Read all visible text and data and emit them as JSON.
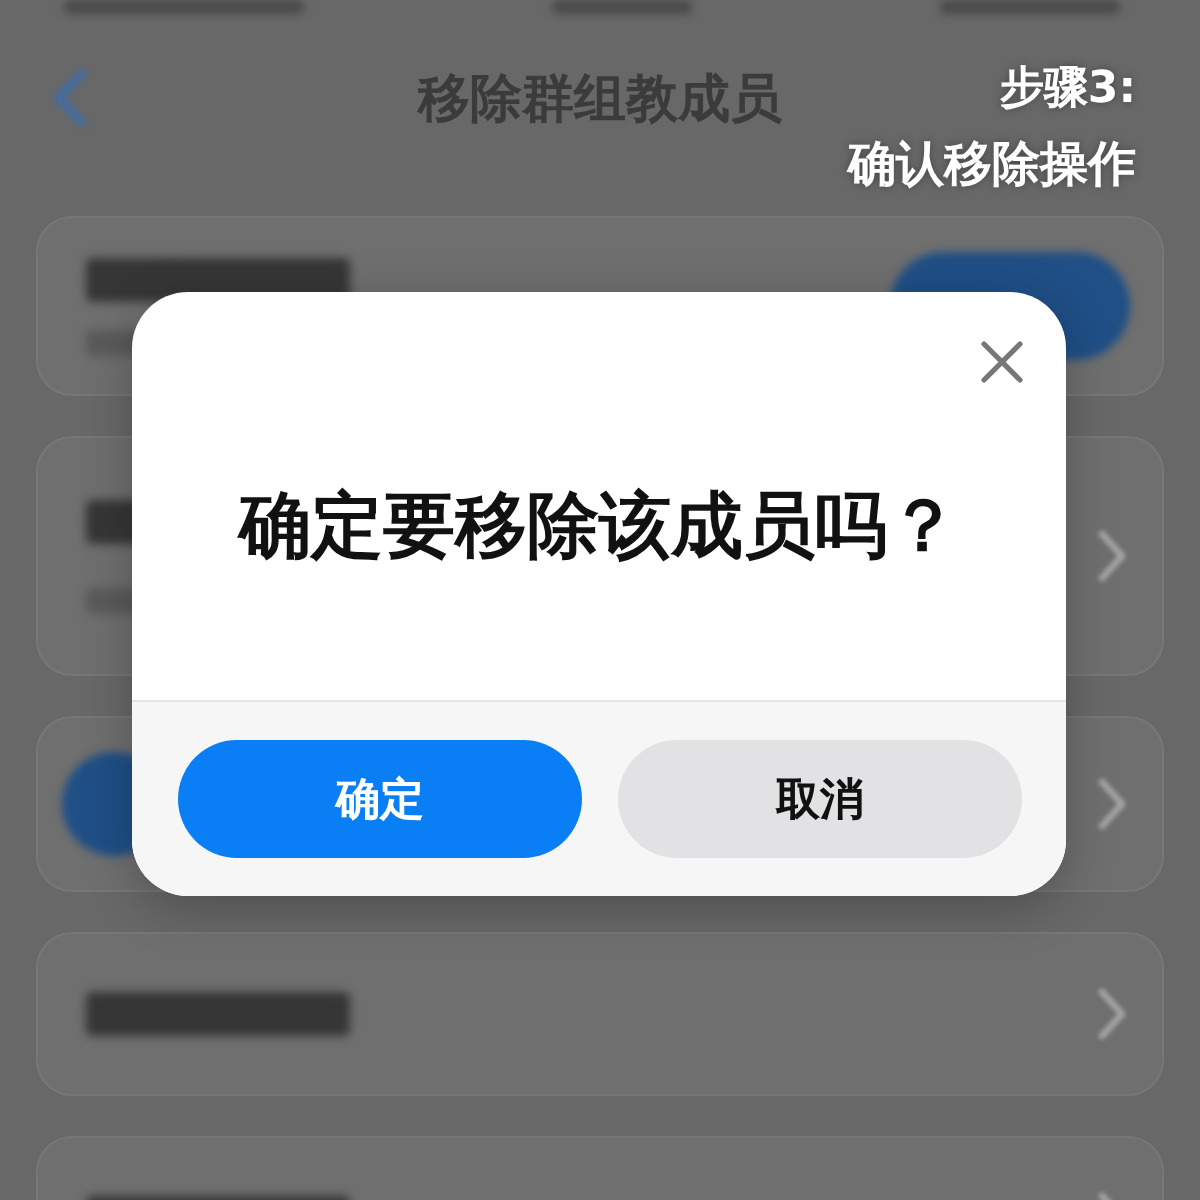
{
  "page": {
    "title": "移除群组教成员",
    "cards": [
      {
        "kind": "pill_row"
      },
      {
        "kind": "double_row"
      },
      {
        "kind": "avatar_row"
      },
      {
        "kind": "single_row"
      },
      {
        "kind": "single_row"
      }
    ]
  },
  "step": {
    "title": "步骤3:",
    "subtitle": "确认移除操作"
  },
  "dialog": {
    "question": "确定要移除该成员吗？",
    "buttons": [
      {
        "label": "确定",
        "kind": "primary"
      },
      {
        "label": "取消",
        "kind": "secondary"
      }
    ]
  }
}
